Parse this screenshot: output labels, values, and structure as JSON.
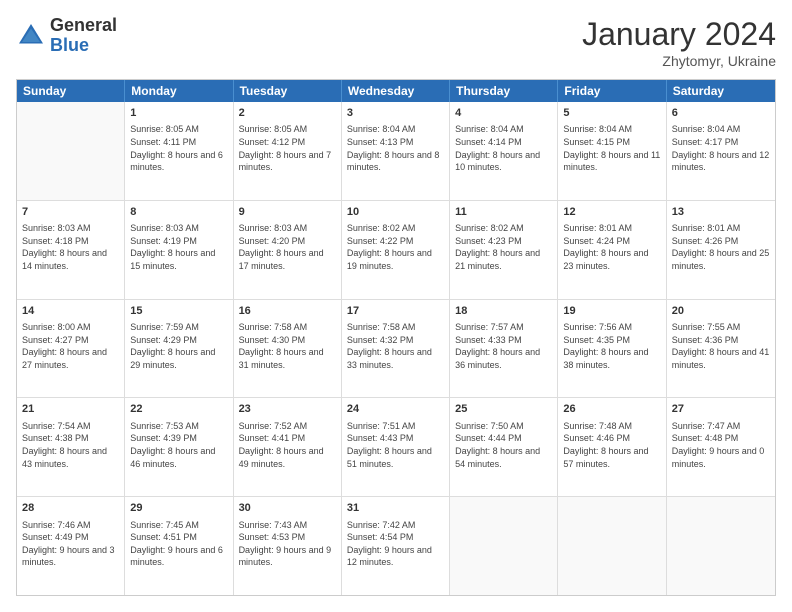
{
  "header": {
    "logo": {
      "general": "General",
      "blue": "Blue"
    },
    "title": "January 2024",
    "location": "Zhytomyr, Ukraine"
  },
  "weekdays": [
    "Sunday",
    "Monday",
    "Tuesday",
    "Wednesday",
    "Thursday",
    "Friday",
    "Saturday"
  ],
  "weeks": [
    [
      {
        "day": "",
        "sunrise": "",
        "sunset": "",
        "daylight": ""
      },
      {
        "day": "1",
        "sunrise": "Sunrise: 8:05 AM",
        "sunset": "Sunset: 4:11 PM",
        "daylight": "Daylight: 8 hours and 6 minutes."
      },
      {
        "day": "2",
        "sunrise": "Sunrise: 8:05 AM",
        "sunset": "Sunset: 4:12 PM",
        "daylight": "Daylight: 8 hours and 7 minutes."
      },
      {
        "day": "3",
        "sunrise": "Sunrise: 8:04 AM",
        "sunset": "Sunset: 4:13 PM",
        "daylight": "Daylight: 8 hours and 8 minutes."
      },
      {
        "day": "4",
        "sunrise": "Sunrise: 8:04 AM",
        "sunset": "Sunset: 4:14 PM",
        "daylight": "Daylight: 8 hours and 10 minutes."
      },
      {
        "day": "5",
        "sunrise": "Sunrise: 8:04 AM",
        "sunset": "Sunset: 4:15 PM",
        "daylight": "Daylight: 8 hours and 11 minutes."
      },
      {
        "day": "6",
        "sunrise": "Sunrise: 8:04 AM",
        "sunset": "Sunset: 4:17 PM",
        "daylight": "Daylight: 8 hours and 12 minutes."
      }
    ],
    [
      {
        "day": "7",
        "sunrise": "Sunrise: 8:03 AM",
        "sunset": "Sunset: 4:18 PM",
        "daylight": "Daylight: 8 hours and 14 minutes."
      },
      {
        "day": "8",
        "sunrise": "Sunrise: 8:03 AM",
        "sunset": "Sunset: 4:19 PM",
        "daylight": "Daylight: 8 hours and 15 minutes."
      },
      {
        "day": "9",
        "sunrise": "Sunrise: 8:03 AM",
        "sunset": "Sunset: 4:20 PM",
        "daylight": "Daylight: 8 hours and 17 minutes."
      },
      {
        "day": "10",
        "sunrise": "Sunrise: 8:02 AM",
        "sunset": "Sunset: 4:22 PM",
        "daylight": "Daylight: 8 hours and 19 minutes."
      },
      {
        "day": "11",
        "sunrise": "Sunrise: 8:02 AM",
        "sunset": "Sunset: 4:23 PM",
        "daylight": "Daylight: 8 hours and 21 minutes."
      },
      {
        "day": "12",
        "sunrise": "Sunrise: 8:01 AM",
        "sunset": "Sunset: 4:24 PM",
        "daylight": "Daylight: 8 hours and 23 minutes."
      },
      {
        "day": "13",
        "sunrise": "Sunrise: 8:01 AM",
        "sunset": "Sunset: 4:26 PM",
        "daylight": "Daylight: 8 hours and 25 minutes."
      }
    ],
    [
      {
        "day": "14",
        "sunrise": "Sunrise: 8:00 AM",
        "sunset": "Sunset: 4:27 PM",
        "daylight": "Daylight: 8 hours and 27 minutes."
      },
      {
        "day": "15",
        "sunrise": "Sunrise: 7:59 AM",
        "sunset": "Sunset: 4:29 PM",
        "daylight": "Daylight: 8 hours and 29 minutes."
      },
      {
        "day": "16",
        "sunrise": "Sunrise: 7:58 AM",
        "sunset": "Sunset: 4:30 PM",
        "daylight": "Daylight: 8 hours and 31 minutes."
      },
      {
        "day": "17",
        "sunrise": "Sunrise: 7:58 AM",
        "sunset": "Sunset: 4:32 PM",
        "daylight": "Daylight: 8 hours and 33 minutes."
      },
      {
        "day": "18",
        "sunrise": "Sunrise: 7:57 AM",
        "sunset": "Sunset: 4:33 PM",
        "daylight": "Daylight: 8 hours and 36 minutes."
      },
      {
        "day": "19",
        "sunrise": "Sunrise: 7:56 AM",
        "sunset": "Sunset: 4:35 PM",
        "daylight": "Daylight: 8 hours and 38 minutes."
      },
      {
        "day": "20",
        "sunrise": "Sunrise: 7:55 AM",
        "sunset": "Sunset: 4:36 PM",
        "daylight": "Daylight: 8 hours and 41 minutes."
      }
    ],
    [
      {
        "day": "21",
        "sunrise": "Sunrise: 7:54 AM",
        "sunset": "Sunset: 4:38 PM",
        "daylight": "Daylight: 8 hours and 43 minutes."
      },
      {
        "day": "22",
        "sunrise": "Sunrise: 7:53 AM",
        "sunset": "Sunset: 4:39 PM",
        "daylight": "Daylight: 8 hours and 46 minutes."
      },
      {
        "day": "23",
        "sunrise": "Sunrise: 7:52 AM",
        "sunset": "Sunset: 4:41 PM",
        "daylight": "Daylight: 8 hours and 49 minutes."
      },
      {
        "day": "24",
        "sunrise": "Sunrise: 7:51 AM",
        "sunset": "Sunset: 4:43 PM",
        "daylight": "Daylight: 8 hours and 51 minutes."
      },
      {
        "day": "25",
        "sunrise": "Sunrise: 7:50 AM",
        "sunset": "Sunset: 4:44 PM",
        "daylight": "Daylight: 8 hours and 54 minutes."
      },
      {
        "day": "26",
        "sunrise": "Sunrise: 7:48 AM",
        "sunset": "Sunset: 4:46 PM",
        "daylight": "Daylight: 8 hours and 57 minutes."
      },
      {
        "day": "27",
        "sunrise": "Sunrise: 7:47 AM",
        "sunset": "Sunset: 4:48 PM",
        "daylight": "Daylight: 9 hours and 0 minutes."
      }
    ],
    [
      {
        "day": "28",
        "sunrise": "Sunrise: 7:46 AM",
        "sunset": "Sunset: 4:49 PM",
        "daylight": "Daylight: 9 hours and 3 minutes."
      },
      {
        "day": "29",
        "sunrise": "Sunrise: 7:45 AM",
        "sunset": "Sunset: 4:51 PM",
        "daylight": "Daylight: 9 hours and 6 minutes."
      },
      {
        "day": "30",
        "sunrise": "Sunrise: 7:43 AM",
        "sunset": "Sunset: 4:53 PM",
        "daylight": "Daylight: 9 hours and 9 minutes."
      },
      {
        "day": "31",
        "sunrise": "Sunrise: 7:42 AM",
        "sunset": "Sunset: 4:54 PM",
        "daylight": "Daylight: 9 hours and 12 minutes."
      },
      {
        "day": "",
        "sunrise": "",
        "sunset": "",
        "daylight": ""
      },
      {
        "day": "",
        "sunrise": "",
        "sunset": "",
        "daylight": ""
      },
      {
        "day": "",
        "sunrise": "",
        "sunset": "",
        "daylight": ""
      }
    ]
  ]
}
